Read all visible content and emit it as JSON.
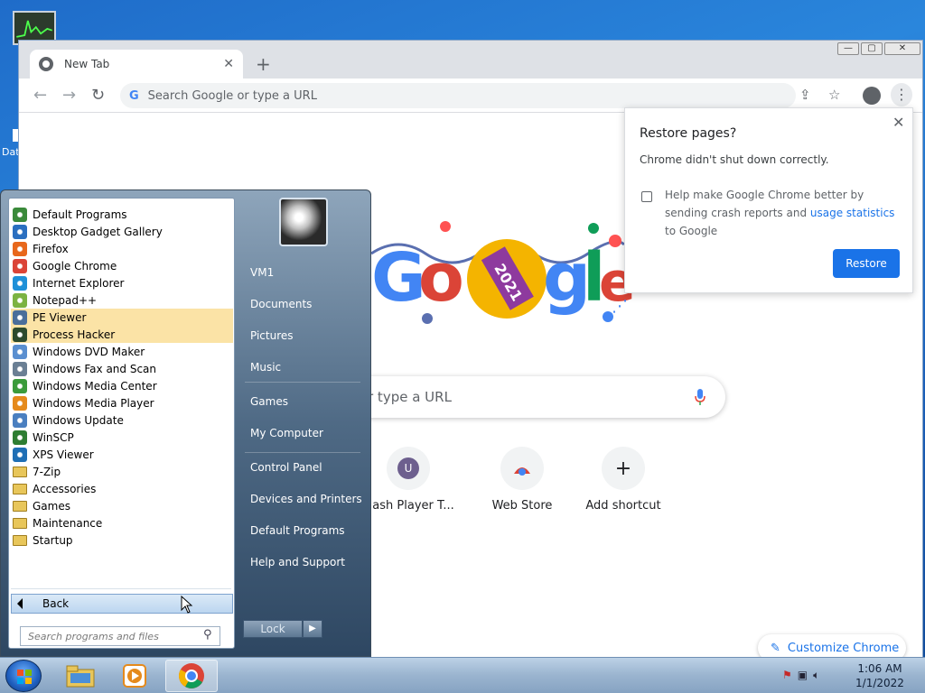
{
  "desktop": {
    "label": "Dat"
  },
  "chrome": {
    "tab_title": "New Tab",
    "tab_close": "✕",
    "new_tab": "+",
    "omnibox_placeholder": "Search Google or type a URL",
    "search_placeholder": "r type a URL",
    "win_buttons": [
      "—",
      "▢",
      "✕"
    ],
    "shortcuts": [
      {
        "label": "Flash Player T...",
        "icon": "U"
      },
      {
        "label": "Web Store",
        "icon": "webstore-icon"
      },
      {
        "label": "Add shortcut",
        "icon": "+"
      }
    ],
    "customize": "Customize Chrome",
    "doodle_text": "2021"
  },
  "restore": {
    "title": "Restore pages?",
    "message": "Chrome didn't shut down correctly.",
    "checkbox_pre": "Help make Google Chrome better by sending crash reports and ",
    "checkbox_link": "usage statistics",
    "checkbox_post": " to Google",
    "button": "Restore",
    "close": "✕"
  },
  "startmenu": {
    "programs": [
      {
        "label": "Default Programs",
        "icon": "default-programs-icon",
        "color": "#3a8a3a",
        "highlight": false
      },
      {
        "label": "Desktop Gadget Gallery",
        "icon": "gadget-icon",
        "color": "#2a6fc0",
        "highlight": false
      },
      {
        "label": "Firefox",
        "icon": "firefox-icon",
        "color": "#e8671b",
        "highlight": false
      },
      {
        "label": "Google Chrome",
        "icon": "chrome-icon",
        "color": "#db4437",
        "highlight": false
      },
      {
        "label": "Internet Explorer",
        "icon": "ie-icon",
        "color": "#1e90d8",
        "highlight": false
      },
      {
        "label": "Notepad++",
        "icon": "notepadpp-icon",
        "color": "#7cb342",
        "highlight": false
      },
      {
        "label": "PE Viewer",
        "icon": "pe-viewer-icon",
        "color": "#4a6e9a",
        "highlight": true
      },
      {
        "label": "Process Hacker",
        "icon": "process-hacker-icon",
        "color": "#2d4a2d",
        "highlight": true
      },
      {
        "label": "Windows DVD Maker",
        "icon": "dvd-maker-icon",
        "color": "#5a8fd0",
        "highlight": false
      },
      {
        "label": "Windows Fax and Scan",
        "icon": "fax-icon",
        "color": "#6a7f94",
        "highlight": false
      },
      {
        "label": "Windows Media Center",
        "icon": "media-center-icon",
        "color": "#3b9b3b",
        "highlight": false
      },
      {
        "label": "Windows Media Player",
        "icon": "media-player-icon",
        "color": "#e58a1c",
        "highlight": false
      },
      {
        "label": "Windows Update",
        "icon": "windows-update-icon",
        "color": "#4a7fc0",
        "highlight": false
      },
      {
        "label": "WinSCP",
        "icon": "winscp-icon",
        "color": "#2e7d32",
        "highlight": false
      },
      {
        "label": "XPS Viewer",
        "icon": "xps-viewer-icon",
        "color": "#1f6fb5",
        "highlight": false
      },
      {
        "label": "7-Zip",
        "icon": "folder-icon",
        "color": "#e8c65a",
        "highlight": false
      },
      {
        "label": "Accessories",
        "icon": "folder-icon",
        "color": "#e8c65a",
        "highlight": false
      },
      {
        "label": "Games",
        "icon": "folder-icon",
        "color": "#e8c65a",
        "highlight": false
      },
      {
        "label": "Maintenance",
        "icon": "folder-icon",
        "color": "#e8c65a",
        "highlight": false
      },
      {
        "label": "Startup",
        "icon": "folder-icon",
        "color": "#e8c65a",
        "highlight": false
      }
    ],
    "back": "Back",
    "search_placeholder": "Search programs and files",
    "right_items": [
      {
        "label": "VM1"
      },
      {
        "label": "Documents"
      },
      {
        "label": "Pictures"
      },
      {
        "label": "Music"
      },
      {
        "label": "Games"
      },
      {
        "label": "My Computer"
      },
      {
        "label": "Control Panel"
      },
      {
        "label": "Devices and Printers"
      },
      {
        "label": "Default Programs"
      },
      {
        "label": "Help and Support"
      }
    ],
    "lock": "Lock",
    "lock_arrow": "▶"
  },
  "taskbar": {
    "time": "1:06 AM",
    "date": "1/1/2022"
  }
}
